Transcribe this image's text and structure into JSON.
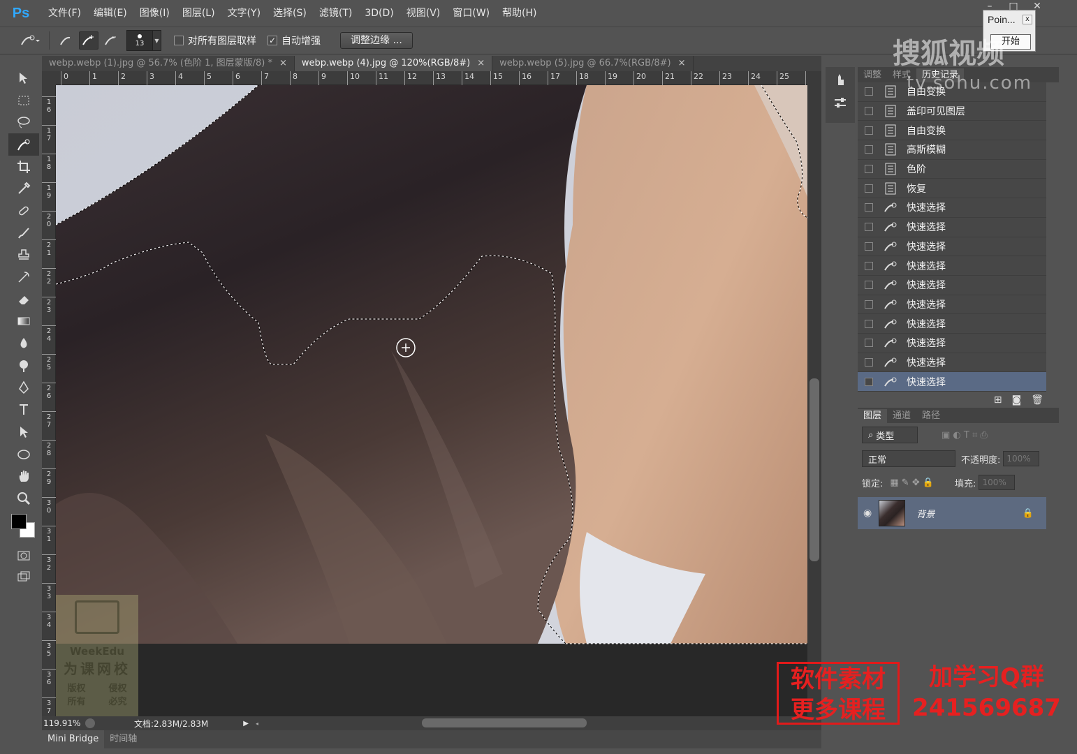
{
  "app": {
    "logo": "Ps"
  },
  "menu": [
    "文件(F)",
    "编辑(E)",
    "图像(I)",
    "图层(L)",
    "文字(Y)",
    "选择(S)",
    "滤镜(T)",
    "3D(D)",
    "视图(V)",
    "窗口(W)",
    "帮助(H)"
  ],
  "options": {
    "brush_size": "13",
    "sample_all_label": "对所有图层取样",
    "sample_all_checked": false,
    "auto_enhance_label": "自动增强",
    "auto_enhance_checked": true,
    "refine_edge_label": "调整边缘 ..."
  },
  "doc_tabs": [
    {
      "title": "webp.webp (1).jpg @ 56.7% (色阶 1, 图层蒙版/8) *",
      "active": false
    },
    {
      "title": "webp.webp (4).jpg @ 120%(RGB/8#)",
      "active": true
    },
    {
      "title": "webp.webp (5).jpg @ 66.7%(RGB/8#)",
      "active": false
    }
  ],
  "ruler_h": [
    "0",
    "1",
    "2",
    "3",
    "4",
    "5",
    "6",
    "7",
    "8",
    "9",
    "10",
    "11",
    "12",
    "13",
    "14",
    "15",
    "16",
    "17",
    "18",
    "19",
    "20",
    "21",
    "22",
    "23",
    "24",
    "25",
    "2"
  ],
  "ruler_v": [
    "16",
    "17",
    "18",
    "19",
    "20",
    "21",
    "22",
    "23",
    "24",
    "25",
    "26",
    "27",
    "28",
    "29",
    "30",
    "31",
    "32",
    "33",
    "34",
    "35",
    "36",
    "37"
  ],
  "status": {
    "zoom": "119.91%",
    "doc_info": "文档:2.83M/2.83M"
  },
  "bottom_tabs": [
    "Mini Bridge",
    "时间轴"
  ],
  "history_panel": {
    "tabs": [
      "调整",
      "样式",
      "历史记录"
    ],
    "items": [
      {
        "label": "自由变换",
        "icon": "doc-icon"
      },
      {
        "label": "盖印可见图层",
        "icon": "doc-icon"
      },
      {
        "label": "自由变换",
        "icon": "doc-icon"
      },
      {
        "label": "高斯模糊",
        "icon": "doc-icon"
      },
      {
        "label": "色阶",
        "icon": "doc-icon"
      },
      {
        "label": "恢复",
        "icon": "doc-icon"
      },
      {
        "label": "快速选择",
        "icon": "quick-select-icon"
      },
      {
        "label": "快速选择",
        "icon": "quick-select-icon"
      },
      {
        "label": "快速选择",
        "icon": "quick-select-icon"
      },
      {
        "label": "快速选择",
        "icon": "quick-select-icon"
      },
      {
        "label": "快速选择",
        "icon": "quick-select-icon"
      },
      {
        "label": "快速选择",
        "icon": "quick-select-icon"
      },
      {
        "label": "快速选择",
        "icon": "quick-select-icon"
      },
      {
        "label": "快速选择",
        "icon": "quick-select-icon"
      },
      {
        "label": "快速选择",
        "icon": "quick-select-icon"
      },
      {
        "label": "快速选择",
        "icon": "quick-select-icon",
        "selected": true
      }
    ]
  },
  "layers_panel": {
    "tabs": [
      "图层",
      "通道",
      "路径"
    ],
    "kind_label": "类型",
    "blend_mode": "正常",
    "opacity_label": "不透明度:",
    "opacity_value": "100%",
    "lock_label": "锁定:",
    "fill_label": "填充:",
    "fill_value": "100%",
    "layers": [
      {
        "name": "背景",
        "visible": true,
        "locked": true
      }
    ]
  },
  "popup": {
    "title": "Poin...",
    "button": "开始"
  },
  "watermarks": {
    "sohu": "搜狐视频",
    "sohu_url": "tv.sohu.com",
    "red_box_line1": "软件素材",
    "red_box_line2": "更多课程",
    "qq_line1": "加学习Q群",
    "qq_line2": "241569687",
    "weekedu_brand": "WeekEdu",
    "weekedu_cn": "为课网校",
    "weekedu_rights1": "版权",
    "weekedu_rights2": "所有",
    "weekedu_rights3": "侵权",
    "weekedu_rights4": "必究"
  },
  "colors": {
    "accent": "#30a8ff",
    "selection": "#5a6a85",
    "watermark_red": "#e62020"
  }
}
